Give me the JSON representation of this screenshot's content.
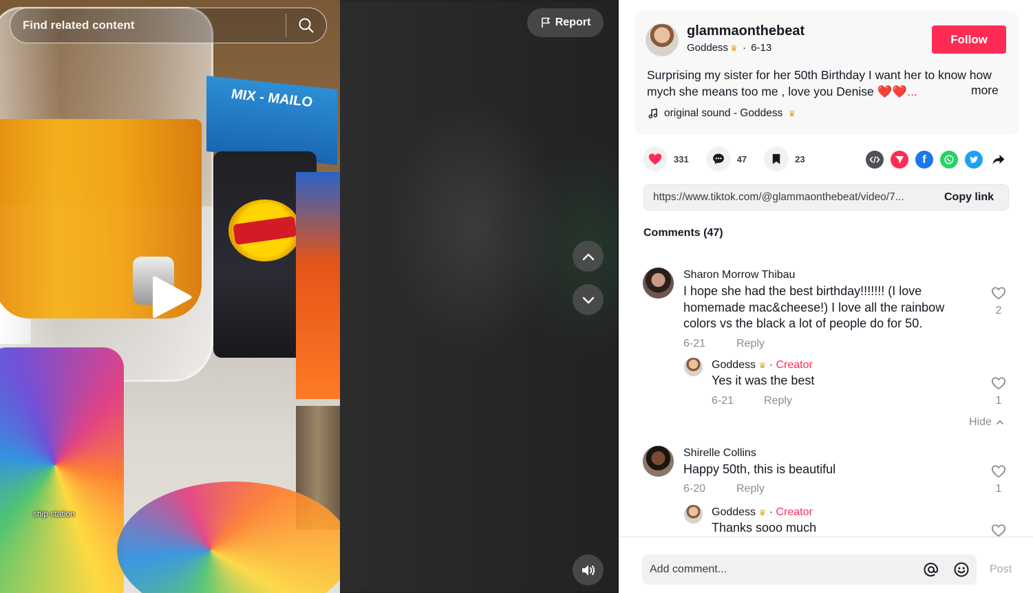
{
  "video": {
    "search_placeholder": "Find related content",
    "report_label": "Report",
    "caption_overlay": "ship station",
    "product_text_mix": "MIX - MAILO"
  },
  "author": {
    "username": "glammaonthebeat",
    "nickname": "Goddess",
    "date": "6-13",
    "follow_label": "Follow"
  },
  "description": {
    "text": "Surprising my sister for her 50th Birthday I want her to know how mych she means too me , love you Denise",
    "hearts": "❤️❤️...",
    "more_label": "more",
    "music": "original sound - Goddess"
  },
  "stats": {
    "likes": "331",
    "comments": "47",
    "saves": "23"
  },
  "share": {
    "link": "https://www.tiktok.com/@glammaonthebeat/video/7...",
    "copy_label": "Copy link"
  },
  "comments": {
    "title": "Comments (47)",
    "items": [
      {
        "name": "Sharon Morrow Thibau",
        "text": "I hope she had the best birthday!!!!!!! (I love homemade mac&cheese!) I love all the rainbow colors vs the black a lot of people do for 50.",
        "date": "6-21",
        "reply_label": "Reply",
        "likes": "2",
        "reply": {
          "name": "Goddess",
          "tag": "Creator",
          "text": "Yes it was the best",
          "date": "6-21",
          "reply_label": "Reply",
          "likes": "1"
        },
        "hide_label": "Hide"
      },
      {
        "name": "Shirelle Collins",
        "text": "Happy 50th, this is beautiful",
        "date": "6-20",
        "reply_label": "Reply",
        "likes": "1",
        "reply": {
          "name": "Goddess",
          "tag": "Creator",
          "text": "Thanks sooo much"
        }
      }
    ]
  },
  "composer": {
    "placeholder": "Add comment...",
    "post_label": "Post"
  },
  "colors": {
    "accent": "#fe2c55",
    "heart": "#fe2c55",
    "crown": "#e8a317",
    "facebook": "#1877f2",
    "whatsapp": "#25d366",
    "twitter": "#1da1f2",
    "embed": "#505157",
    "friends": "#fe2c55"
  }
}
